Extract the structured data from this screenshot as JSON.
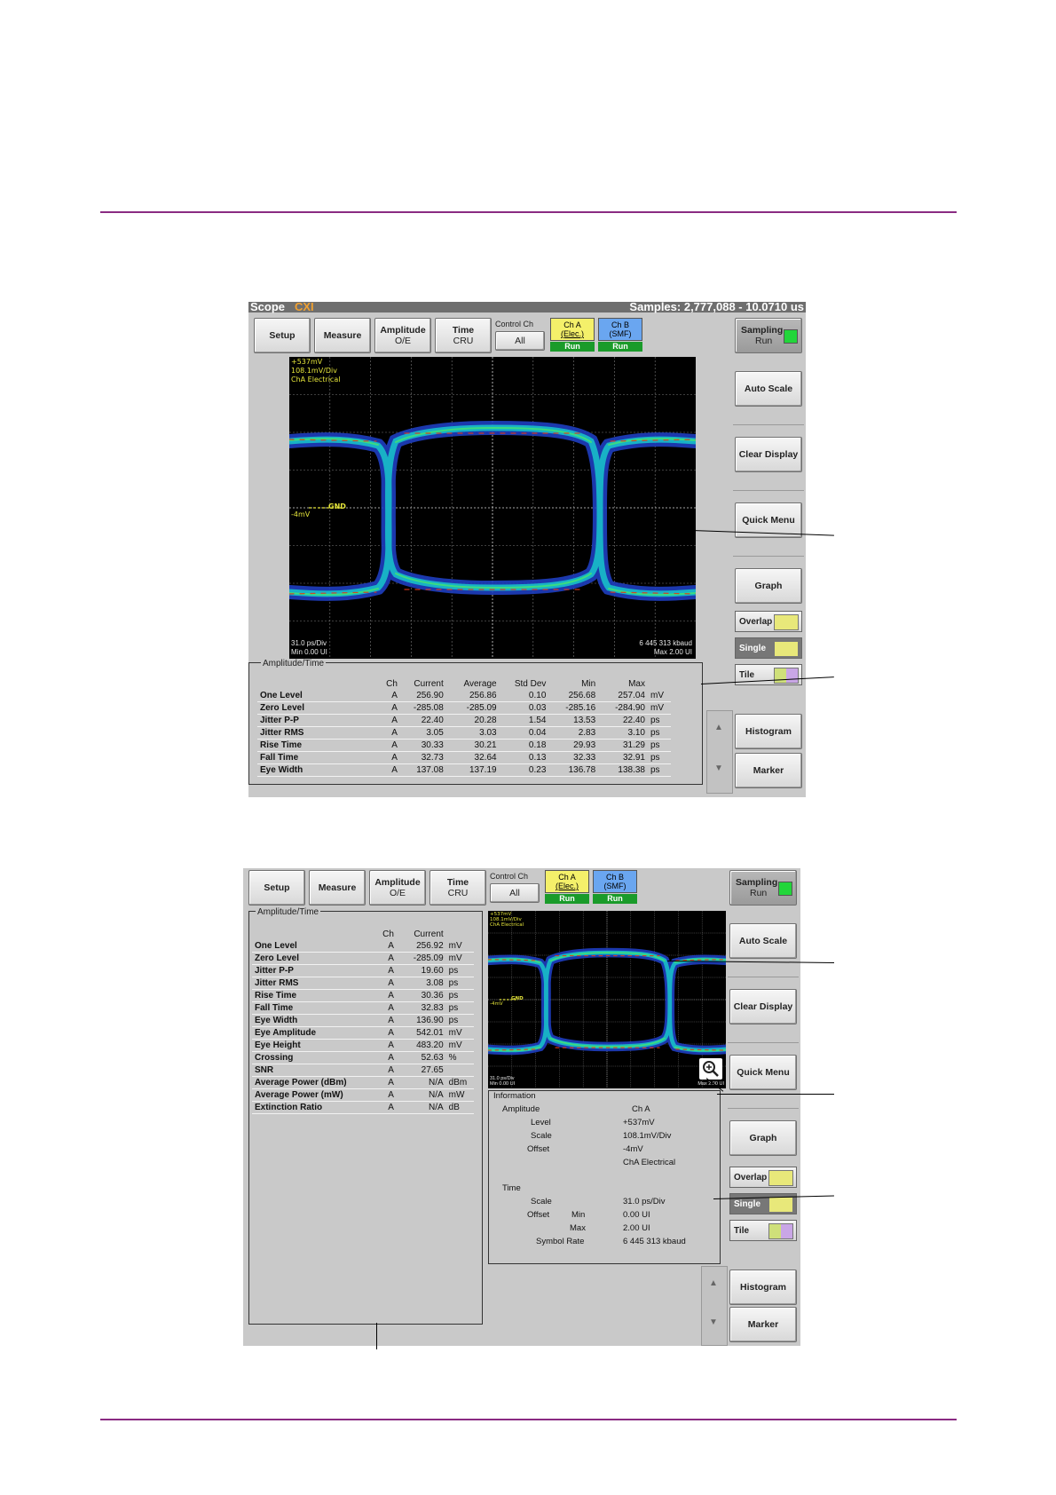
{
  "scope1": {
    "title": "Scope",
    "title_tag": "CXI",
    "samples": "Samples: 2,777,088 - 10.0710 us",
    "buttons": {
      "setup": "Setup",
      "measure": "Measure",
      "amplitude": "Amplitude",
      "amplitude_sub": "O/E",
      "time": "Time",
      "time_sub": "CRU",
      "control_ch": "Control Ch",
      "all": "All",
      "cha": "Ch A",
      "cha_sub": "(Elec.)",
      "chb": "Ch B",
      "chb_sub": "(SMF)",
      "run": "Run",
      "sampling": "Sampling",
      "sampling_sub": "Run",
      "auto_scale": "Auto Scale",
      "clear_display": "Clear Display",
      "quick_menu": "Quick Menu",
      "graph": "Graph",
      "overlap": "Overlap",
      "single": "Single",
      "tile": "Tile",
      "histogram": "Histogram",
      "marker": "Marker"
    },
    "plot": {
      "top_left": [
        "+537mV",
        "108.1mV/Div",
        "ChA Electrical"
      ],
      "gnd_label": "GND",
      "offset_label": "-4mV",
      "bottom_left": [
        "31.0 ps/Div",
        "Min 0.00 UI"
      ],
      "bottom_right": [
        "6 445 313 kbaud",
        "Max 2.00 UI"
      ]
    },
    "table": {
      "title": "Amplitude/Time",
      "headers": [
        "Ch",
        "Current",
        "Average",
        "Std Dev",
        "Min",
        "Max"
      ],
      "rows": [
        [
          "One Level",
          "A",
          "256.90",
          "256.86",
          "0.10",
          "256.68",
          "257.04",
          "mV"
        ],
        [
          "Zero Level",
          "A",
          "-285.08",
          "-285.09",
          "0.03",
          "-285.16",
          "-284.90",
          "mV"
        ],
        [
          "Jitter P-P",
          "A",
          "22.40",
          "20.28",
          "1.54",
          "13.53",
          "22.40",
          "ps"
        ],
        [
          "Jitter RMS",
          "A",
          "3.05",
          "3.03",
          "0.04",
          "2.83",
          "3.10",
          "ps"
        ],
        [
          "Rise Time",
          "A",
          "30.33",
          "30.21",
          "0.18",
          "29.93",
          "31.29",
          "ps"
        ],
        [
          "Fall Time",
          "A",
          "32.73",
          "32.64",
          "0.13",
          "32.33",
          "32.91",
          "ps"
        ],
        [
          "Eye Width",
          "A",
          "137.08",
          "137.19",
          "0.23",
          "136.78",
          "138.38",
          "ps"
        ]
      ]
    }
  },
  "scope2": {
    "buttons": {
      "setup": "Setup",
      "measure": "Measure",
      "amplitude": "Amplitude",
      "amplitude_sub": "O/E",
      "time": "Time",
      "time_sub": "CRU",
      "control_ch": "Control Ch",
      "all": "All",
      "cha": "Ch A",
      "cha_sub": "(Elec.)",
      "chb": "Ch B",
      "chb_sub": "(SMF)",
      "run": "Run",
      "sampling": "Sampling",
      "sampling_sub": "Run",
      "auto_scale": "Auto Scale",
      "clear_display": "Clear Display",
      "quick_menu": "Quick Menu",
      "graph": "Graph",
      "overlap": "Overlap",
      "single": "Single",
      "tile": "Tile",
      "histogram": "Histogram",
      "marker": "Marker"
    },
    "table": {
      "title": "Amplitude/Time",
      "headers": [
        "Ch",
        "Current"
      ],
      "rows": [
        [
          "One Level",
          "A",
          "256.92",
          "mV"
        ],
        [
          "Zero Level",
          "A",
          "-285.09",
          "mV"
        ],
        [
          "Jitter P-P",
          "A",
          "19.60",
          "ps"
        ],
        [
          "Jitter RMS",
          "A",
          "3.08",
          "ps"
        ],
        [
          "Rise Time",
          "A",
          "30.36",
          "ps"
        ],
        [
          "Fall Time",
          "A",
          "32.83",
          "ps"
        ],
        [
          "Eye Width",
          "A",
          "136.90",
          "ps"
        ],
        [
          "Eye Amplitude",
          "A",
          "542.01",
          "mV"
        ],
        [
          "Eye Height",
          "A",
          "483.20",
          "mV"
        ],
        [
          "Crossing",
          "A",
          "52.63",
          "%"
        ],
        [
          "SNR",
          "A",
          "27.65",
          ""
        ],
        [
          "Average Power (dBm)",
          "A",
          "N/A",
          "dBm"
        ],
        [
          "Average Power (mW)",
          "A",
          "N/A",
          "mW"
        ],
        [
          "Extinction Ratio",
          "A",
          "N/A",
          "dB"
        ]
      ]
    },
    "plot": {
      "top_left": [
        "+537mV",
        "108.1mV/Div",
        "ChA Electrical"
      ],
      "gnd_label": "GND",
      "offset_label": "-4mV",
      "bottom_left": [
        "31.0 ps/Div",
        "Min 0.00 UI"
      ],
      "bottom_right": [
        "Max 2.00 UI"
      ]
    },
    "info": {
      "title": "Information",
      "amplitude": "Amplitude",
      "cha": "Ch A",
      "level_label": "Level",
      "level": "+537mV",
      "scale_label": "Scale",
      "scale": "108.1mV/Div",
      "offset_label": "Offset",
      "offset": "-4mV",
      "source": "ChA  Electrical",
      "time": "Time",
      "tscale_label": "Scale",
      "tscale": "31.0 ps/Div",
      "toffset_label": "Offset",
      "min_label": "Min",
      "min": "0.00 UI",
      "max_label": "Max",
      "max": "2.00 UI",
      "symbol_rate_label": "Symbol Rate",
      "symbol_rate": "6 445 313 kbaud"
    }
  }
}
